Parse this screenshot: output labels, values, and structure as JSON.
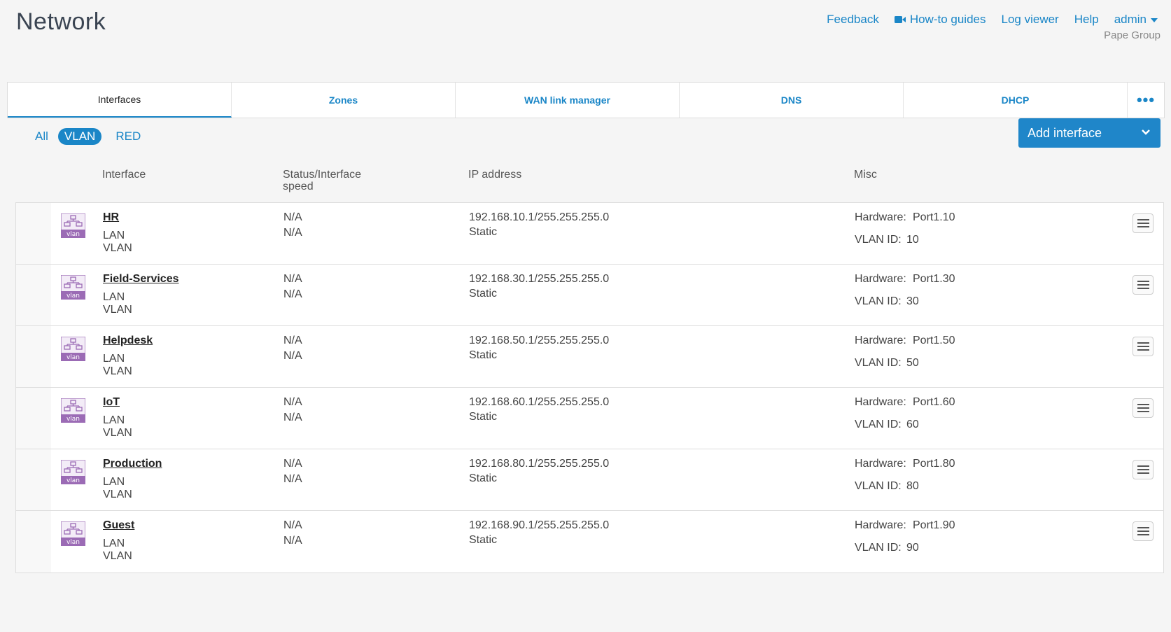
{
  "header": {
    "title": "Network",
    "links": {
      "feedback": "Feedback",
      "howto": "How-to guides",
      "logviewer": "Log viewer",
      "help": "Help",
      "user": "admin"
    },
    "org": "Pape Group"
  },
  "tabs": {
    "interfaces": "Interfaces",
    "zones": "Zones",
    "wan": "WAN link manager",
    "dns": "DNS",
    "dhcp": "DHCP",
    "more": "•••"
  },
  "filters": {
    "all": "All",
    "vlan": "VLAN",
    "red": "RED"
  },
  "add_button": "Add interface",
  "columns": {
    "interface": "Interface",
    "status_line1": "Status/Interface",
    "status_line2": "speed",
    "ip": "IP address",
    "misc": "Misc"
  },
  "icon_label": "vlan",
  "labels": {
    "hardware": "Hardware:",
    "vlan_id": "VLAN ID:"
  },
  "rows": [
    {
      "name": "HR",
      "zone": "LAN",
      "type": "VLAN",
      "status": "N/A",
      "speed": "N/A",
      "ip": "192.168.10.1/255.255.255.0",
      "mode": "Static",
      "hardware": "Port1.10",
      "vlan_id": "10"
    },
    {
      "name": "Field-Services",
      "zone": "LAN",
      "type": "VLAN",
      "status": "N/A",
      "speed": "N/A",
      "ip": "192.168.30.1/255.255.255.0",
      "mode": "Static",
      "hardware": "Port1.30",
      "vlan_id": "30"
    },
    {
      "name": "Helpdesk",
      "zone": "LAN",
      "type": "VLAN",
      "status": "N/A",
      "speed": "N/A",
      "ip": "192.168.50.1/255.255.255.0",
      "mode": "Static",
      "hardware": "Port1.50",
      "vlan_id": "50"
    },
    {
      "name": "IoT",
      "zone": "LAN",
      "type": "VLAN",
      "status": "N/A",
      "speed": "N/A",
      "ip": "192.168.60.1/255.255.255.0",
      "mode": "Static",
      "hardware": "Port1.60",
      "vlan_id": "60"
    },
    {
      "name": "Production",
      "zone": "LAN",
      "type": "VLAN",
      "status": "N/A",
      "speed": "N/A",
      "ip": "192.168.80.1/255.255.255.0",
      "mode": "Static",
      "hardware": "Port1.80",
      "vlan_id": "80"
    },
    {
      "name": "Guest",
      "zone": "LAN",
      "type": "VLAN",
      "status": "N/A",
      "speed": "N/A",
      "ip": "192.168.90.1/255.255.255.0",
      "mode": "Static",
      "hardware": "Port1.90",
      "vlan_id": "90"
    }
  ],
  "colors": {
    "accent": "#1a86c7",
    "vlan_icon": "#9b6bb5"
  }
}
